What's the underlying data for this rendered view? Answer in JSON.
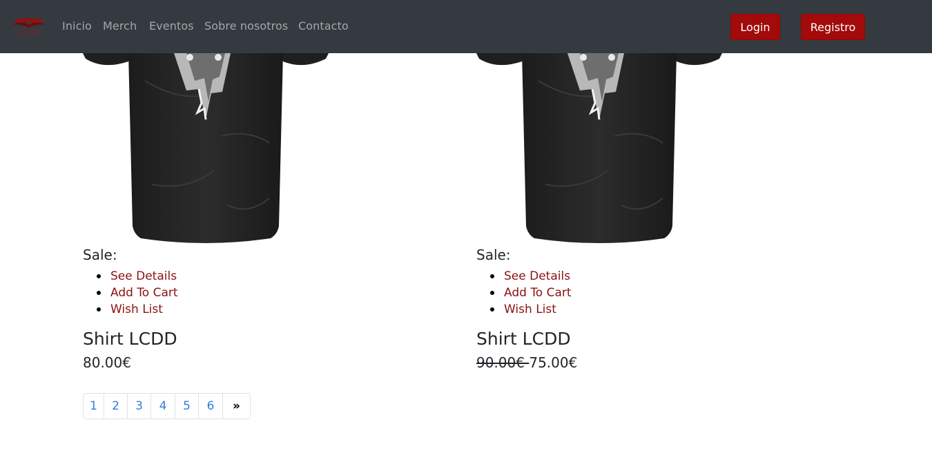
{
  "nav": {
    "logo_text": "LCDD",
    "links": [
      "Inicio",
      "Merch",
      "Eventos",
      "Sobre nosotros",
      "Contacto"
    ],
    "login_label": "Login",
    "register_label": "Registro"
  },
  "products": [
    {
      "image": "black-dragon-tshirt",
      "sale_label": "Sale:",
      "actions": [
        "See Details",
        "Add To Cart",
        "Wish List"
      ],
      "title": "Shirt LCDD",
      "old_price": "",
      "price": "80.00€"
    },
    {
      "image": "black-dragon-tshirt",
      "sale_label": "Sale:",
      "actions": [
        "See Details",
        "Add To Cart",
        "Wish List"
      ],
      "title": "Shirt LCDD",
      "old_price": "90.00€ ",
      "price": "75.00€"
    }
  ],
  "pagination": {
    "pages": [
      "1",
      "2",
      "3",
      "4",
      "5",
      "6"
    ],
    "next_label": "»"
  },
  "colors": {
    "navbar_bg": "#343a40",
    "brand_red": "#a30a0a",
    "link_red": "#8c1010",
    "pagination_blue": "#2f7ed8"
  }
}
